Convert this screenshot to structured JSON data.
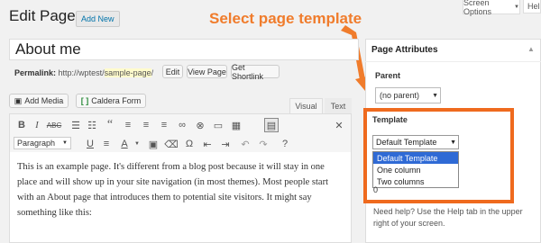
{
  "header": {
    "title": "Edit Page",
    "add_new": "Add New",
    "screen_options": "Screen Options",
    "help": "Help"
  },
  "post": {
    "title_value": "About me",
    "permalink_label": "Permalink:",
    "permalink_base": "http://wptest/",
    "permalink_slug": "sample-page",
    "permalink_end": "/",
    "edit_label": "Edit",
    "view_label": "View Page",
    "shortlink_label": "Get Shortlink"
  },
  "media": {
    "add_media": "Add Media",
    "caldera": "Caldera Form"
  },
  "editor_tabs": {
    "visual": "Visual",
    "text": "Text"
  },
  "toolbar": {
    "row1_icons": [
      "bold-icon",
      "italic-icon",
      "strikethrough-icon",
      "bullet-list-icon",
      "numbered-list-icon",
      "blockquote-icon",
      "align-left-icon",
      "align-center-icon",
      "align-right-icon",
      "link-icon",
      "unlink-icon",
      "read-more-icon",
      "fullscreen-icon",
      "kitchen-sink-icon"
    ],
    "format_value": "Paragraph"
  },
  "content": {
    "body": "This is an example page. It's different from a blog post because it will stay in one place and will show up in your site navigation (in most themes). Most people start with an About page that introduces them to potential site visitors. It might say something like this:"
  },
  "sidebar": {
    "title": "Page Attributes",
    "parent_label": "Parent",
    "parent_value": "(no parent)",
    "template_label": "Template",
    "template_value": "Default Template",
    "template_options": [
      "Default Template",
      "One column",
      "Two columns"
    ],
    "order_value": "0",
    "help_text": "Need help? Use the Help tab in the upper right of your screen."
  },
  "annotation": {
    "text": "Select page template"
  },
  "colors": {
    "accent": "#ef6a1e",
    "link": "#0073aa",
    "selected": "#2f6ad5"
  }
}
